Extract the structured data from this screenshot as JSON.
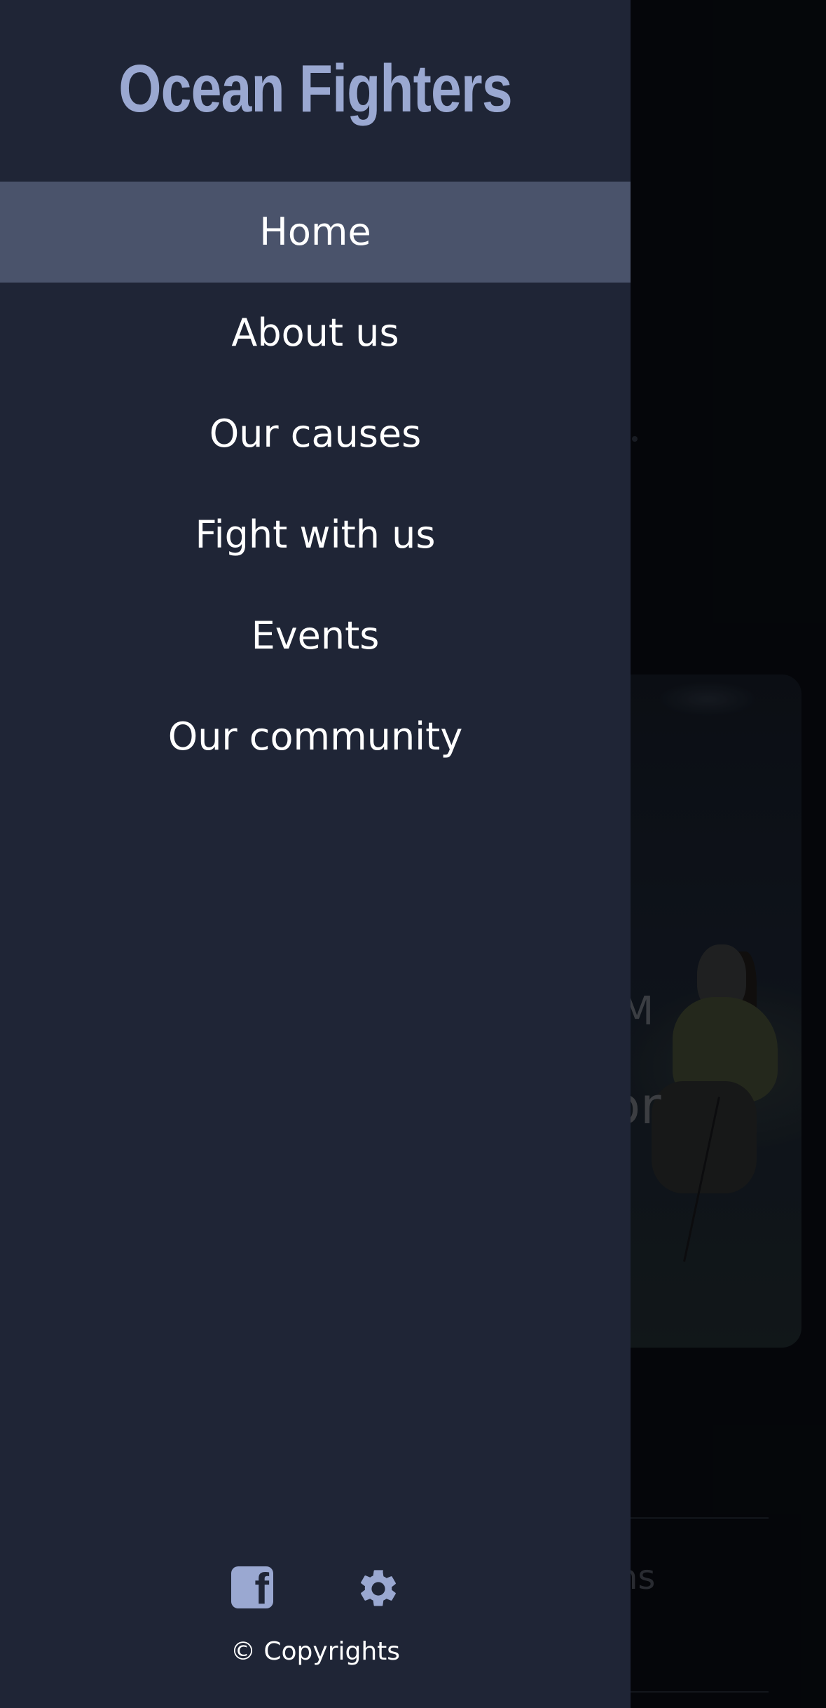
{
  "drawer": {
    "brand": "Ocean Fighters",
    "nav_items": [
      {
        "label": "Home",
        "active": true
      },
      {
        "label": "About us",
        "active": false
      },
      {
        "label": "Our causes",
        "active": false
      },
      {
        "label": "Fight with us",
        "active": false
      },
      {
        "label": "Events",
        "active": false
      },
      {
        "label": "Our community",
        "active": false
      }
    ],
    "footer_icons": [
      "facebook-icon",
      "gear-icon"
    ],
    "copyright": "© Copyrights"
  },
  "background": {
    "fragments": [
      "M",
      "or",
      "ns",
      "."
    ]
  },
  "colors": {
    "drawer_bg": "#1f2536",
    "active_item_bg": "#4a536b",
    "brand": "#9aa8d1",
    "text": "#ffffff"
  }
}
